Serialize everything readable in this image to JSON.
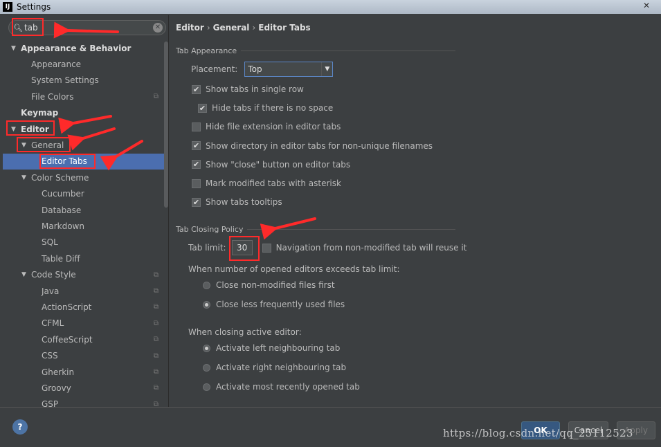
{
  "window": {
    "title": "Settings",
    "app_icon": "IJ",
    "close": "✕"
  },
  "search": {
    "value": "tab",
    "clear": "✕"
  },
  "tree": [
    {
      "label": "Appearance & Behavior",
      "level": 0,
      "arrow": true,
      "bold": true
    },
    {
      "label": "Appearance",
      "level": 1
    },
    {
      "label": "System Settings",
      "level": 1
    },
    {
      "label": "File Colors",
      "level": 1,
      "copy": true
    },
    {
      "label": "Keymap",
      "level": 0,
      "bold": true
    },
    {
      "label": "Editor",
      "level": 0,
      "arrow": true,
      "bold": true
    },
    {
      "label": "General",
      "level": 1,
      "arrow": true
    },
    {
      "label": "Editor Tabs",
      "level": 2,
      "selected": true
    },
    {
      "label": "Color Scheme",
      "level": 1,
      "arrow": true
    },
    {
      "label": "Cucumber",
      "level": 2
    },
    {
      "label": "Database",
      "level": 2
    },
    {
      "label": "Markdown",
      "level": 2
    },
    {
      "label": "SQL",
      "level": 2
    },
    {
      "label": "Table Diff",
      "level": 2
    },
    {
      "label": "Code Style",
      "level": 1,
      "arrow": true,
      "copy": true
    },
    {
      "label": "Java",
      "level": 2,
      "copy": true
    },
    {
      "label": "ActionScript",
      "level": 2,
      "copy": true
    },
    {
      "label": "CFML",
      "level": 2,
      "copy": true
    },
    {
      "label": "CoffeeScript",
      "level": 2,
      "copy": true
    },
    {
      "label": "CSS",
      "level": 2,
      "copy": true
    },
    {
      "label": "Gherkin",
      "level": 2,
      "copy": true
    },
    {
      "label": "Groovy",
      "level": 2,
      "copy": true
    },
    {
      "label": "GSP",
      "level": 2,
      "copy": true
    }
  ],
  "breadcrumb": [
    "Editor",
    "General",
    "Editor Tabs"
  ],
  "tab_appearance": {
    "title": "Tab Appearance",
    "placement_label": "Placement:",
    "placement_value": "Top",
    "options": [
      {
        "label": "Show tabs in single row",
        "checked": true,
        "indent": false
      },
      {
        "label": "Hide tabs if there is no space",
        "checked": true,
        "indent": true
      },
      {
        "label": "Hide file extension in editor tabs",
        "checked": false,
        "indent": false
      },
      {
        "label": "Show directory in editor tabs for non-unique filenames",
        "checked": true,
        "indent": false
      },
      {
        "label": "Show \"close\" button on editor tabs",
        "checked": true,
        "indent": false
      },
      {
        "label": "Mark modified tabs with asterisk",
        "checked": false,
        "indent": false
      },
      {
        "label": "Show tabs tooltips",
        "checked": true,
        "indent": false
      }
    ]
  },
  "tab_closing": {
    "title": "Tab Closing Policy",
    "limit_label": "Tab limit:",
    "limit_value": "30",
    "nav_reuse": {
      "label": "Navigation from non-modified tab will reuse it",
      "checked": false
    },
    "exceeds_label": "When number of opened editors exceeds tab limit:",
    "exceeds_options": [
      {
        "label": "Close non-modified files first",
        "selected": false
      },
      {
        "label": "Close less frequently used files",
        "selected": true
      }
    ],
    "closing_label": "When closing active editor:",
    "closing_options": [
      {
        "label": "Activate left neighbouring tab",
        "selected": true
      },
      {
        "label": "Activate right neighbouring tab",
        "selected": false
      },
      {
        "label": "Activate most recently opened tab",
        "selected": false
      }
    ]
  },
  "footer": {
    "help": "?",
    "ok": "OK",
    "cancel": "Cancel",
    "apply": "Apply"
  },
  "watermark": "https://blog.csdn.net/qq_25112523",
  "colors": {
    "selection": "#4b6eaf",
    "annotation": "#ff2a2a",
    "background": "#3c3f41"
  }
}
